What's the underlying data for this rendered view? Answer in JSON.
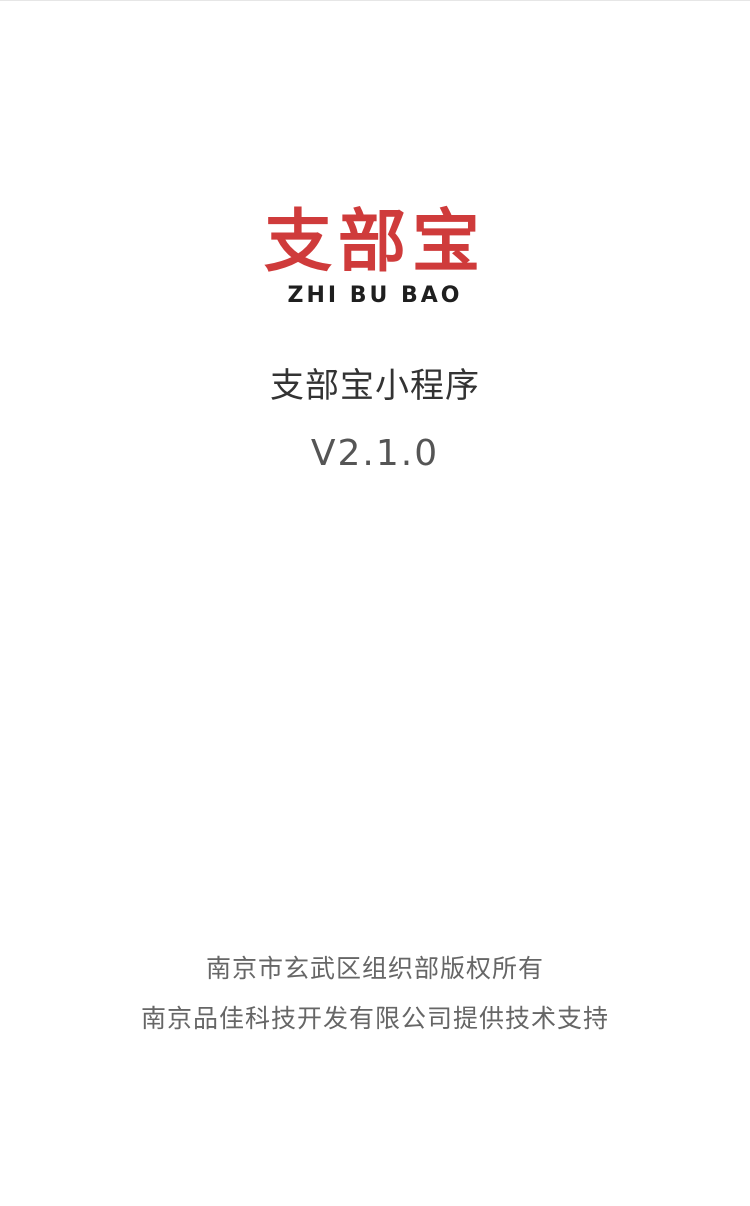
{
  "logo": {
    "cn": "支部宝",
    "en": "ZHI BU BAO"
  },
  "app": {
    "name": "支部宝小程序",
    "version": "V2.1.0"
  },
  "footer": {
    "copyright": "南京市玄武区组织部版权所有",
    "support": "南京品佳科技开发有限公司提供技术支持"
  },
  "colors": {
    "brand_red": "#cf3b3b",
    "text_dark": "#333333",
    "text_gray": "#666666"
  }
}
